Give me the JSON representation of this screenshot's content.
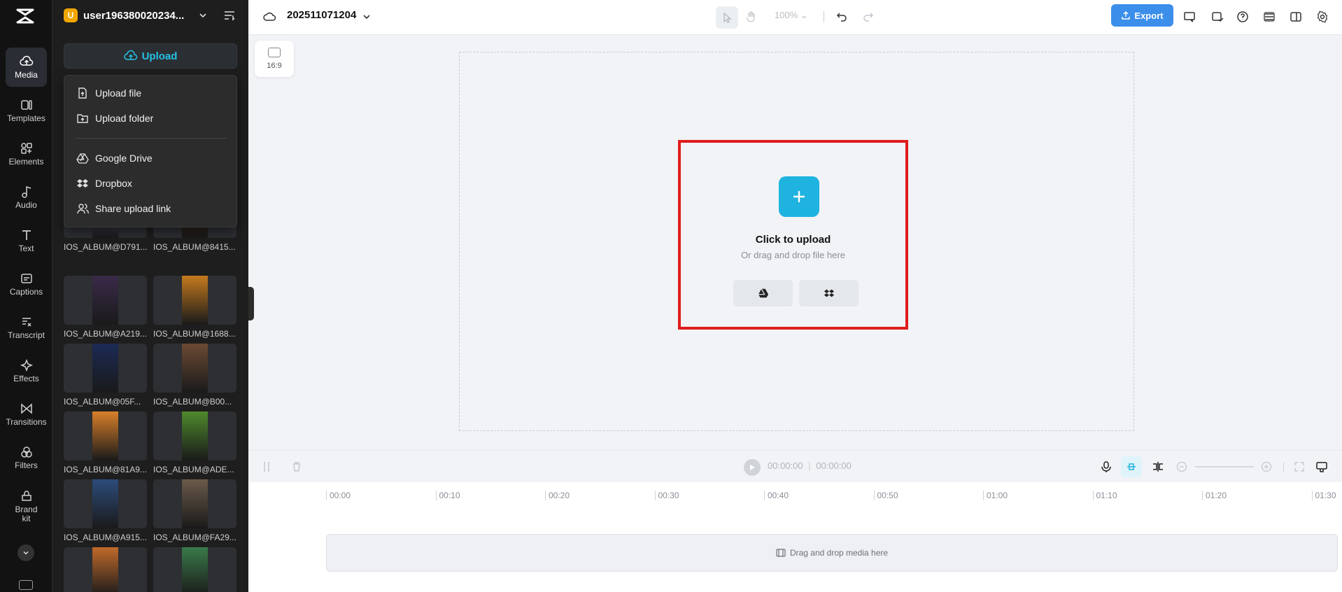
{
  "app": {
    "project_name": "202511071204",
    "zoom": "100%",
    "export_label": "Export"
  },
  "rail": {
    "items": [
      {
        "label": "Media",
        "icon": "cloud-upload-icon"
      },
      {
        "label": "Templates",
        "icon": "templates-icon"
      },
      {
        "label": "Elements",
        "icon": "elements-icon"
      },
      {
        "label": "Audio",
        "icon": "music-note-icon"
      },
      {
        "label": "Text",
        "icon": "text-icon"
      },
      {
        "label": "Captions",
        "icon": "captions-icon"
      },
      {
        "label": "Transcript",
        "icon": "transcript-icon"
      },
      {
        "label": "Effects",
        "icon": "effects-icon"
      },
      {
        "label": "Transitions",
        "icon": "transitions-icon"
      },
      {
        "label": "Filters",
        "icon": "filters-icon"
      },
      {
        "label": "Brand kit",
        "icon": "brand-kit-icon"
      }
    ]
  },
  "panel": {
    "user_initial": "U",
    "username": "user196380020234...",
    "upload_label": "Upload",
    "menu": {
      "upload_file": "Upload file",
      "upload_folder": "Upload folder",
      "google_drive": "Google Drive",
      "dropbox": "Dropbox",
      "share_link": "Share upload link"
    },
    "media": [
      {
        "name": "IOS_ALBUM@D791...",
        "color": "#8a7fb4"
      },
      {
        "name": "IOS_ALBUM@8415...",
        "color": "#5b3a22"
      },
      {
        "name": "IOS_ALBUM@A219...",
        "color": "#3a2a4a"
      },
      {
        "name": "IOS_ALBUM@1688...",
        "color": "#c47a1e"
      },
      {
        "name": "IOS_ALBUM@05F...",
        "color": "#1b2a55"
      },
      {
        "name": "IOS_ALBUM@B00...",
        "color": "#6b4a33"
      },
      {
        "name": "IOS_ALBUM@81A9...",
        "color": "#d9802a"
      },
      {
        "name": "IOS_ALBUM@ADE...",
        "color": "#4f8a2c"
      },
      {
        "name": "IOS_ALBUM@A915...",
        "color": "#2c4c7a"
      },
      {
        "name": "IOS_ALBUM@FA29...",
        "color": "#6a5a4a"
      },
      {
        "name": "",
        "color": "#c06a2a"
      },
      {
        "name": "",
        "color": "#3a7a4a"
      }
    ]
  },
  "canvas": {
    "ratio": "16:9",
    "click_upload": "Click to upload",
    "drag_hint": "Or drag and drop file here"
  },
  "timeline": {
    "current_time": "00:00:00",
    "total_time": "00:00:00",
    "ticks": [
      "00:00",
      "00:10",
      "00:20",
      "00:30",
      "00:40",
      "00:50",
      "01:00",
      "01:10",
      "01:20",
      "01:30"
    ],
    "drop_hint": "Drag and drop media here"
  }
}
